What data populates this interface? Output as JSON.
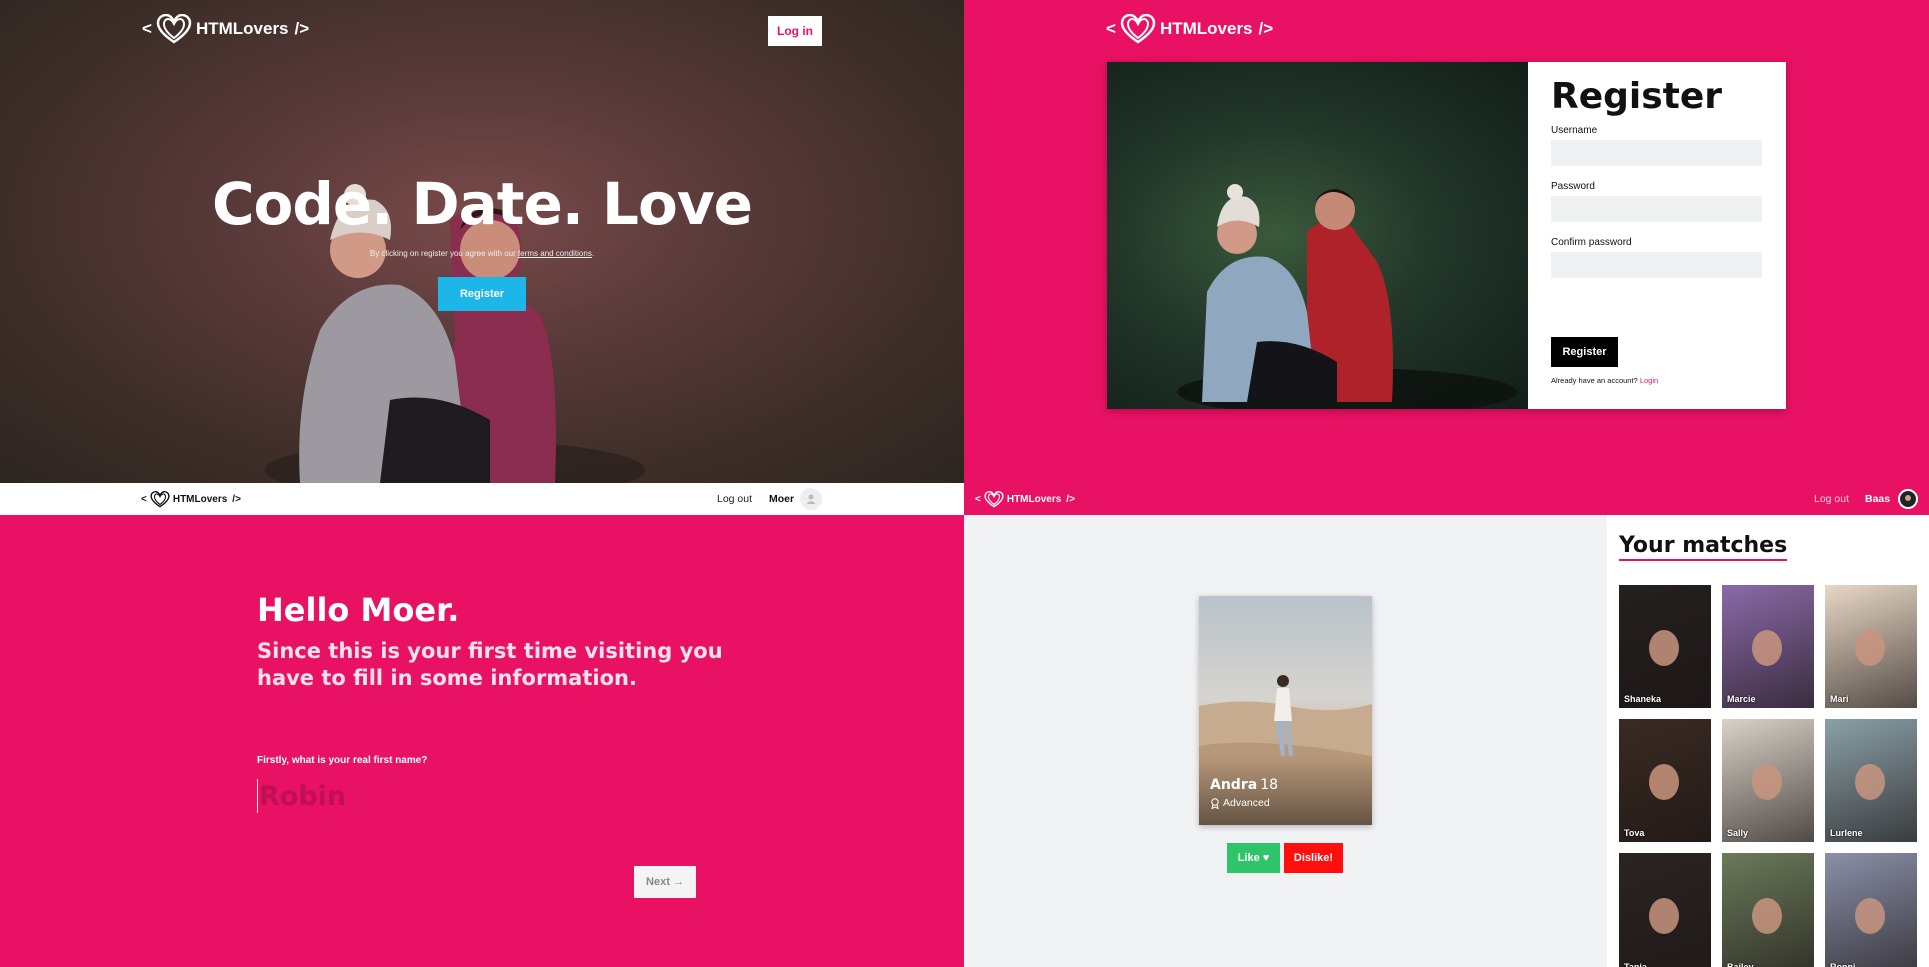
{
  "brand": {
    "name": "HTMLovers",
    "left_bracket": "<",
    "right_bracket": "/>"
  },
  "landing": {
    "login_label": "Log in",
    "headline": "Code. Date. Love",
    "terms_prefix": "By clicking on register you agree with our",
    "terms_link": "terms and conditions",
    "terms_suffix": ".",
    "register_label": "Register"
  },
  "register_page": {
    "title": "Register",
    "username_label": "Username",
    "password_label": "Password",
    "confirm_label": "Confirm password",
    "submit_label": "Register",
    "already_text": "Already have an account?",
    "login_link": "Login"
  },
  "onboarding": {
    "nav": {
      "logout": "Log out",
      "user": "Moer"
    },
    "hello": "Hello Moer.",
    "subtitle": "Since this is your first time visiting you have to fill in some information.",
    "question": "Firstly, what is your real first name?",
    "name_placeholder": "Robin",
    "next_label": "Next"
  },
  "dashboard": {
    "nav": {
      "logout": "Log out",
      "user": "Baas"
    },
    "profile": {
      "name": "Andra",
      "age": "18",
      "level": "Advanced"
    },
    "like_label": "Like ♥",
    "dislike_label": "Dislike!",
    "matches_title": "Your matches",
    "matches": [
      {
        "name": "Shaneka",
        "bg": "#24201e"
      },
      {
        "name": "Marcie",
        "bg": "#8a6aa8"
      },
      {
        "name": "Mari",
        "bg": "#e8d8c6"
      },
      {
        "name": "Tova",
        "bg": "#3a2a22"
      },
      {
        "name": "Sally",
        "bg": "#d9d2c8"
      },
      {
        "name": "Lurlene",
        "bg": "#8aa0a8"
      },
      {
        "name": "Tanja",
        "bg": "#2a2422"
      },
      {
        "name": "Bailey",
        "bg": "#6a7a5a"
      },
      {
        "name": "Ronni",
        "bg": "#8a90a8"
      }
    ]
  },
  "colors": {
    "brand_pink": "#e91163",
    "register_blue": "#1cb6e8",
    "like_green": "#2fc36a",
    "dislike_red": "#ff0e0e"
  }
}
